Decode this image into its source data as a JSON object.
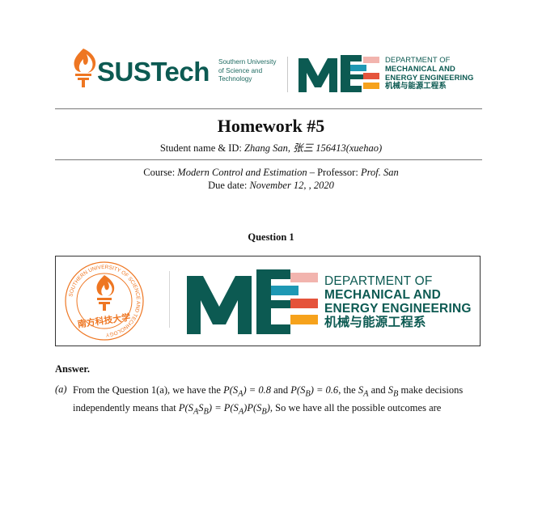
{
  "header": {
    "sustech_wordmark": "SUSTech",
    "sustech_subtitle": [
      "Southern University",
      "of Science and",
      "Technology"
    ],
    "department_lines": [
      "DEPARTMENT OF",
      "MECHANICAL AND",
      "ENERGY ENGINEERING",
      "机械与能源工程系"
    ]
  },
  "document": {
    "title": "Homework #5",
    "student_label": "Student name & ID: ",
    "student_value": "Zhang San, 张三 156413(xuehao)",
    "course_label": "Course: ",
    "course_value": "Modern Control and Estimation",
    "professor_label": " – Professor: ",
    "professor_value": "Prof. San",
    "due_label": "Due date: ",
    "due_value": "November 12, , 2020"
  },
  "question": {
    "title": "Question 1",
    "figure": {
      "seal_ring_text": "SOUTHERN UNIVERSITY OF SCIENCE AND TECHNOLOGY",
      "seal_chinese": "南方科技大学",
      "department_lines": [
        "DEPARTMENT OF",
        "MECHANICAL AND",
        "ENERGY ENGINEERING",
        "机械与能源工程系"
      ]
    }
  },
  "answer": {
    "title": "Answer.",
    "label": "(a)",
    "p1": "From the Question 1(a), we have the ",
    "e1": "P(S",
    "e1sub": "A",
    "e1end": ") = 0.8",
    "p2": " and ",
    "e2": "P(S",
    "e2sub": "B",
    "e2end": ") = 0.6",
    "p3": ", the ",
    "s1": "S",
    "s1sub": "A",
    "p4": " and ",
    "s2": "S",
    "s2sub": "B",
    "p5": " make decisions independently means that ",
    "e3": "P(S",
    "e3sub1": "A",
    "e3mid": "S",
    "e3sub2": "B",
    "e3end": ") = P(S",
    "e3sub3": "A",
    "e3end2": ")P(S",
    "e3sub4": "B",
    "e3end3": ")",
    "p6": ", So we have all the possible outcomes are"
  },
  "colors": {
    "sustech_teal": "#0c5a52",
    "sustech_orange": "#ee7622",
    "stripe_pink": "#f2b4ae",
    "stripe_cyan": "#1e98b4",
    "stripe_red": "#e5533b",
    "stripe_yellow": "#f6a21c"
  }
}
